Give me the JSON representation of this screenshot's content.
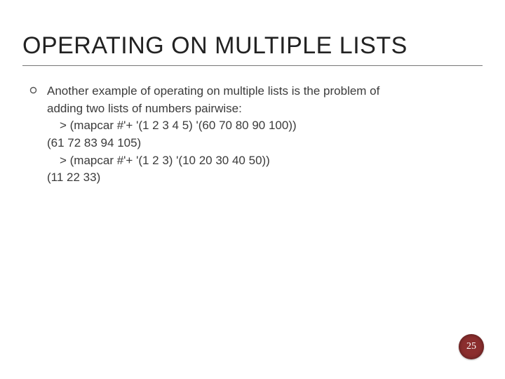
{
  "title": "OPERATING ON MULTIPLE LISTS",
  "bullet": {
    "intro1": "Another example of operating on multiple lists is the problem of",
    "intro2": "adding two lists of numbers pairwise:",
    "code1": "> (mapcar #'+ '(1 2 3 4 5) '(60 70 80 90 100))",
    "result1": "(61 72 83 94 105)",
    "code2": "> (mapcar #'+ '(1 2 3) '(10 20 30 40 50))",
    "result2": "(11 22 33)"
  },
  "page_number": "25"
}
